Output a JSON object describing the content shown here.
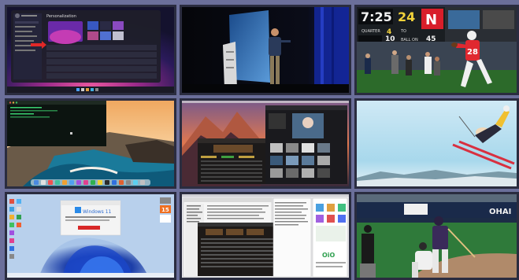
{
  "tiles": [
    {
      "id": "win11-personalization",
      "kind": "screenshot",
      "caption": "Personalization"
    },
    {
      "id": "presenter-stage",
      "kind": "photo"
    },
    {
      "id": "scoreboard-football",
      "kind": "photo",
      "scoreboard": {
        "clock": "7:25",
        "home_score": "24",
        "quarter_label": "QUARTER",
        "quarter": "4",
        "to_label": "TO",
        "yardline": "10",
        "ball_on_label": "BALL ON",
        "ball_on": "45",
        "team_letter": "N",
        "jersey": "28"
      }
    },
    {
      "id": "mac-big-sur-desktop",
      "kind": "screenshot"
    },
    {
      "id": "mac-sierra-photos",
      "kind": "screenshot"
    },
    {
      "id": "ski-jumper",
      "kind": "photo"
    },
    {
      "id": "win11-bloom-desktop",
      "kind": "screenshot",
      "dialog_title": "Windows 11",
      "badge": "15"
    },
    {
      "id": "mac-finder-windows",
      "kind": "screenshot",
      "logo": "OiO"
    },
    {
      "id": "baseball-play",
      "kind": "photo",
      "banner": "OHAI"
    }
  ]
}
